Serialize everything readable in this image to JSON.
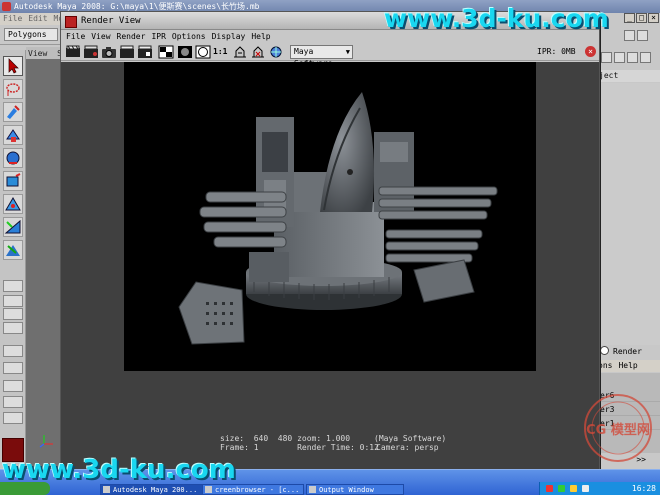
{
  "maya": {
    "title": "Autodesk Maya 2008: G:\\maya\\1\\便斯赛\\scenes\\长竹场.mb",
    "menus": [
      "File",
      "Edit",
      "Mo"
    ],
    "menu_set": "Polygons",
    "shelf_tabs": [
      "View",
      "Sh"
    ],
    "channel_box_label": "ject",
    "render_radio": "Render",
    "layer_menus": [
      "ons",
      "Help"
    ],
    "layers": [
      "er6",
      "er3",
      "er1"
    ],
    "layer_nav": ">>",
    "window_buttons": [
      "_",
      "□",
      "×"
    ]
  },
  "render_view": {
    "title": "Render View",
    "menus": [
      "File",
      "View",
      "Render",
      "IPR",
      "Options",
      "Display",
      "Help"
    ],
    "renderer": "Maya Software",
    "ratio_label": "1:1",
    "ipr_status": "IPR: 0MB",
    "info": {
      "line1_left": "size:  640  480 zoom: 1.000",
      "line1_right": "(Maya Software)",
      "line2_left": "Frame: 1        Render Time: 0:12",
      "line2_right": "Camera: persp"
    }
  },
  "taskbar": {
    "start": "",
    "tasks": [
      "Autodesk Maya 200...",
      "creenbrowser - [c...",
      "Output Window"
    ],
    "clock": "16:28"
  },
  "watermark": {
    "top": "www.3d-ku.com",
    "bottom": "www.3d-ku.com",
    "stamp": "CG 模型网"
  },
  "colors": {
    "watermark": "#19d7f0",
    "maya_logo": "#7a0c0c",
    "taskbar": "#2f63d3"
  }
}
